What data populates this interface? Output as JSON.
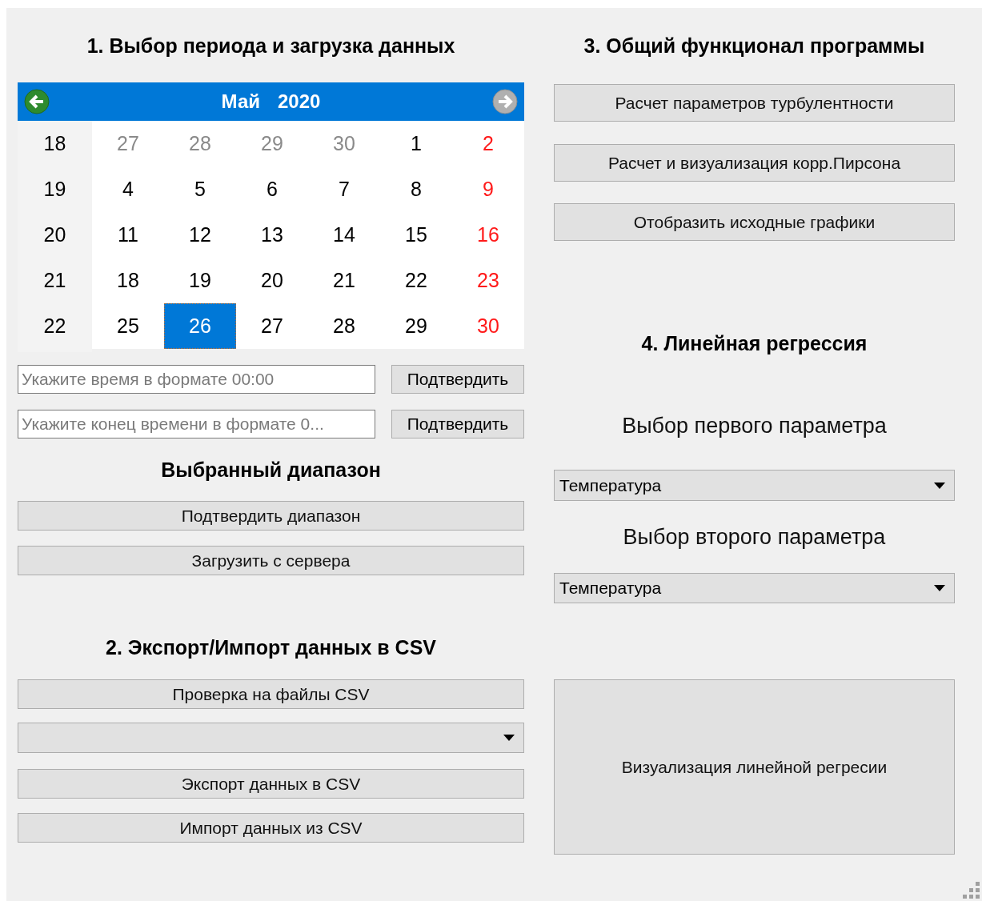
{
  "section_1": {
    "title": "1. Выбор периода и загрузка данных",
    "calendar": {
      "month": "Май",
      "year": "2020",
      "weeks": [
        {
          "number": "18",
          "days": [
            {
              "text": "27",
              "kind": "other",
              "selected": false
            },
            {
              "text": "28",
              "kind": "other",
              "selected": false
            },
            {
              "text": "29",
              "kind": "other",
              "selected": false
            },
            {
              "text": "30",
              "kind": "other",
              "selected": false
            },
            {
              "text": "1",
              "kind": "normal",
              "selected": false
            },
            {
              "text": "2",
              "kind": "weekend",
              "selected": false
            }
          ]
        },
        {
          "number": "19",
          "days": [
            {
              "text": "4",
              "kind": "normal",
              "selected": false
            },
            {
              "text": "5",
              "kind": "normal",
              "selected": false
            },
            {
              "text": "6",
              "kind": "normal",
              "selected": false
            },
            {
              "text": "7",
              "kind": "normal",
              "selected": false
            },
            {
              "text": "8",
              "kind": "normal",
              "selected": false
            },
            {
              "text": "9",
              "kind": "weekend",
              "selected": false
            }
          ]
        },
        {
          "number": "20",
          "days": [
            {
              "text": "11",
              "kind": "normal",
              "selected": false
            },
            {
              "text": "12",
              "kind": "normal",
              "selected": false
            },
            {
              "text": "13",
              "kind": "normal",
              "selected": false
            },
            {
              "text": "14",
              "kind": "normal",
              "selected": false
            },
            {
              "text": "15",
              "kind": "normal",
              "selected": false
            },
            {
              "text": "16",
              "kind": "weekend",
              "selected": false
            }
          ]
        },
        {
          "number": "21",
          "days": [
            {
              "text": "18",
              "kind": "normal",
              "selected": false
            },
            {
              "text": "19",
              "kind": "normal",
              "selected": false
            },
            {
              "text": "20",
              "kind": "normal",
              "selected": false
            },
            {
              "text": "21",
              "kind": "normal",
              "selected": false
            },
            {
              "text": "22",
              "kind": "normal",
              "selected": false
            },
            {
              "text": "23",
              "kind": "weekend",
              "selected": false
            }
          ]
        },
        {
          "number": "22",
          "days": [
            {
              "text": "25",
              "kind": "normal",
              "selected": false
            },
            {
              "text": "26",
              "kind": "normal",
              "selected": true
            },
            {
              "text": "27",
              "kind": "normal",
              "selected": false
            },
            {
              "text": "28",
              "kind": "normal",
              "selected": false
            },
            {
              "text": "29",
              "kind": "normal",
              "selected": false
            },
            {
              "text": "30",
              "kind": "weekend",
              "selected": false
            }
          ]
        }
      ]
    },
    "time_inputs": [
      {
        "placeholder": "Укажите время в формате 00:00",
        "button": "Подтвердить"
      },
      {
        "placeholder": "Укажите конец времени в формате 0...",
        "button": "Подтвердить"
      }
    ],
    "range_title": "Выбранный диапазон",
    "buttons": [
      "Подтвердить диапазон",
      "Загрузить с сервера"
    ]
  },
  "section_2": {
    "title": "2. Экспорт/Импорт данных в CSV",
    "check_button": "Проверка на файлы CSV",
    "buttons": [
      "Экспорт данных в CSV",
      "Импорт данных из CSV"
    ]
  },
  "section_3": {
    "title": "3. Общий функционал программы",
    "buttons": [
      "Расчет параметров турбулентности",
      "Расчет и визуализация корр.Пирсона",
      "Отобразить исходные графики"
    ]
  },
  "section_4": {
    "title": "4. Линейная регрессия",
    "first_label": "Выбор первого параметра",
    "first_value": "Температура",
    "second_label": "Выбор второго параметра",
    "second_value": "Температура",
    "visualize_button": "Визуализация линейной регресии"
  }
}
